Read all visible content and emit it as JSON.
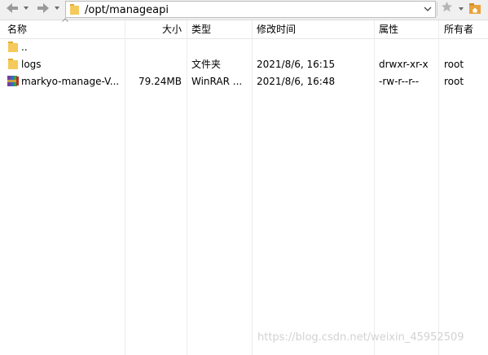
{
  "toolbar": {
    "back_icon": "arrow-left-icon",
    "forward_icon": "arrow-right-icon",
    "path": "/opt/manageapi",
    "bookmark_icon": "star-icon",
    "home_icon": "home-folder-icon"
  },
  "columns": {
    "name": "名称",
    "size": "大小",
    "type": "类型",
    "modified": "修改时间",
    "permissions": "属性",
    "owner": "所有者"
  },
  "rows": [
    {
      "icon": "folder-icon",
      "name": "..",
      "size": "",
      "type": "",
      "modified": "",
      "permissions": "",
      "owner": ""
    },
    {
      "icon": "folder-icon",
      "name": "logs",
      "size": "",
      "type": "文件夹",
      "modified": "2021/8/6, 16:15",
      "permissions": "drwxr-xr-x",
      "owner": "root"
    },
    {
      "icon": "rar-archive-icon",
      "name": "markyo-manage-V...",
      "size": "79.24MB",
      "type": "WinRAR ...",
      "modified": "2021/8/6, 16:48",
      "permissions": "-rw-r--r--",
      "owner": "root"
    }
  ],
  "watermark": "https://blog.csdn.net/weixin_45952509",
  "colors": {
    "folder": "#f5c95b",
    "folder_dark": "#e2ad36",
    "header_bg": "#f0f0f0",
    "home": "#e8a33c"
  }
}
